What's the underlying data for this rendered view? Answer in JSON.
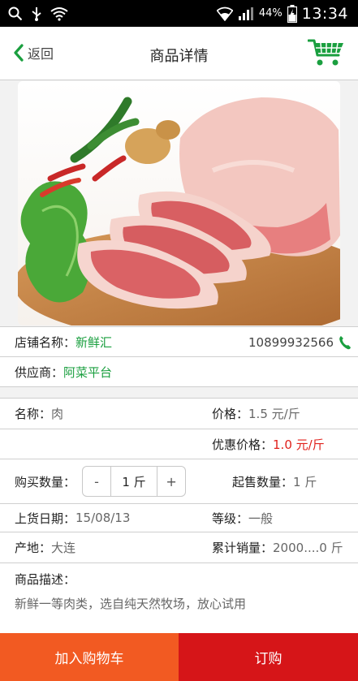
{
  "statusbar": {
    "battery": "44%",
    "time": "13:34"
  },
  "header": {
    "back_label": "返回",
    "title": "商品详情"
  },
  "store": {
    "label": "店铺名称：",
    "name": "新鲜汇",
    "phone": "10899932566"
  },
  "supplier": {
    "label": "供应商：",
    "name": "阿菜平台"
  },
  "product": {
    "name_label": "名称：",
    "name": "肉",
    "price_label": "价格：",
    "price": "1.5 元/斤",
    "discount_label": "优惠价格：",
    "discount": "1.0 元/斤",
    "qty_label": "购买数量：",
    "qty_minus": "-",
    "qty_value": "1 斤",
    "qty_plus": "+",
    "min_label": "起售数量：",
    "min": "1 斤",
    "date_label": "上货日期：",
    "date": "15/08/13",
    "grade_label": "等级：",
    "grade": "一般",
    "origin_label": "产地：",
    "origin": "大连",
    "sales_label": "累计销量：",
    "sales": "2000....0 斤",
    "desc_label": "商品描述：",
    "desc": "新鲜一等肉类，选自纯天然牧场，放心试用"
  },
  "actions": {
    "add_cart": "加入购物车",
    "order": "订购"
  },
  "colors": {
    "accent_green": "#1a9f3f",
    "discount_red": "#e0201b",
    "cart_orange": "#f25a22",
    "order_red": "#d61518"
  }
}
